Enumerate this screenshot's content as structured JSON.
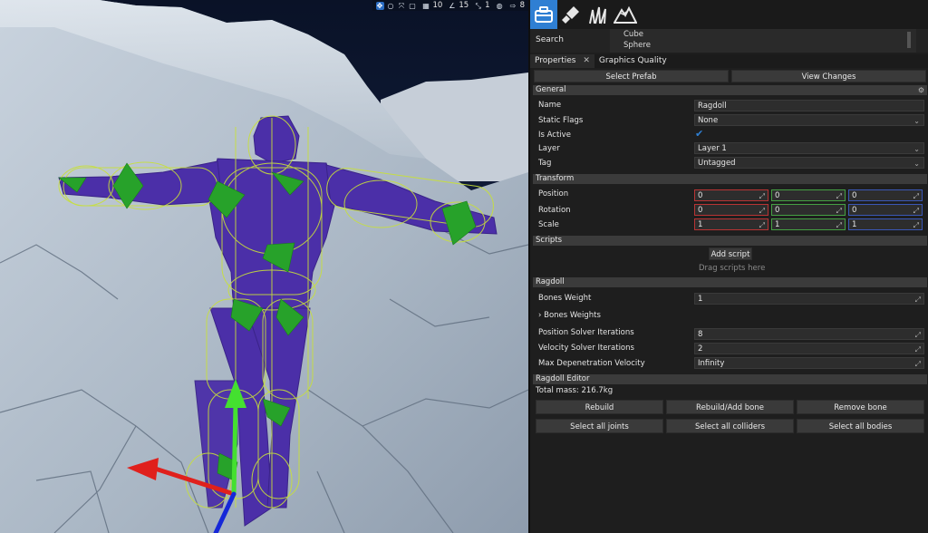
{
  "viewport": {
    "toolbar": {
      "grid_count": "10",
      "angle_snap": "15",
      "scale_snap": "1",
      "speed": "8"
    }
  },
  "panel": {
    "tool_tabs": [
      "toolbox-icon",
      "paint-icon",
      "foliage-icon",
      "terrain-icon"
    ],
    "search": {
      "label": "Search",
      "results": [
        "Cube",
        "Sphere"
      ]
    },
    "tabs": {
      "properties": "Properties",
      "graphics_quality": "Graphics Quality"
    },
    "actions": {
      "select_prefab": "Select Prefab",
      "view_changes": "View Changes"
    },
    "general": {
      "header": "General",
      "name_label": "Name",
      "name_value": "Ragdoll",
      "static_flags_label": "Static Flags",
      "static_flags_value": "None",
      "is_active_label": "Is Active",
      "layer_label": "Layer",
      "layer_value": "Layer 1",
      "tag_label": "Tag",
      "tag_value": "Untagged"
    },
    "transform": {
      "header": "Transform",
      "position_label": "Position",
      "position": [
        "0",
        "0",
        "0"
      ],
      "rotation_label": "Rotation",
      "rotation": [
        "0",
        "0",
        "0"
      ],
      "scale_label": "Scale",
      "scale": [
        "1",
        "1",
        "1"
      ]
    },
    "scripts": {
      "header": "Scripts",
      "add_script": "Add script",
      "drag_hint": "Drag scripts here"
    },
    "ragdoll": {
      "header": "Ragdoll",
      "bones_weight_label": "Bones Weight",
      "bones_weight_value": "1",
      "bones_weights_foldout": "Bones Weights",
      "position_iterations_label": "Position Solver Iterations",
      "position_iterations_value": "8",
      "velocity_iterations_label": "Velocity Solver Iterations",
      "velocity_iterations_value": "2",
      "max_depenetration_label": "Max Depenetration Velocity",
      "max_depenetration_value": "Infinity"
    },
    "ragdoll_editor": {
      "header": "Ragdoll Editor",
      "total_mass": "Total mass: 216.7kg",
      "rebuild": "Rebuild",
      "rebuild_add_bone": "Rebuild/Add bone",
      "remove_bone": "Remove bone",
      "select_all_joints": "Select all joints",
      "select_all_colliders": "Select all colliders",
      "select_all_bodies": "Select all bodies"
    }
  },
  "colors": {
    "accent": "#2f7fd3",
    "body": "#4a2fa8",
    "collider": "#c8e03a",
    "joint": "#2aa62a",
    "axis_x": "#e0201c",
    "axis_y": "#44e030",
    "axis_z": "#1628d8"
  }
}
